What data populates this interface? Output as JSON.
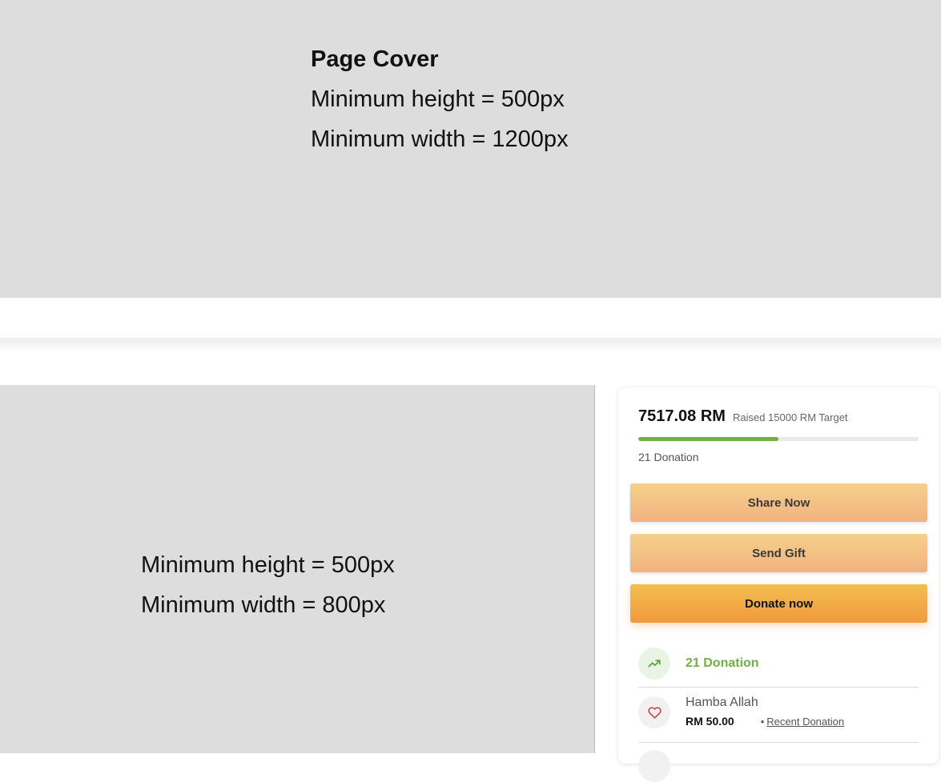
{
  "cover": {
    "title": "Page Cover",
    "min_height": "Minimum height = 500px",
    "min_width": "Minimum width = 1200px"
  },
  "media": {
    "min_height": "Minimum height = 500px",
    "min_width": "Minimum width = 800px"
  },
  "campaign": {
    "raised_amount": "7517.08 RM",
    "raised_sub": "Raised 15000 RM Target",
    "progress": 0.5,
    "donation_count": "21 Donation"
  },
  "actions": {
    "share": "Share Now",
    "gift": "Send Gift",
    "donate": "Donate now"
  },
  "stats": {
    "donations_label": "21 Donation",
    "icon": "trending-up-icon"
  },
  "donations": [
    {
      "name": "Hamba Allah",
      "amount": "RM 50.00",
      "tag": "Recent Donation",
      "icon": "heart-icon"
    }
  ],
  "colors": {
    "accent_green": "#72b043",
    "donate_orange": "#ef9a3f",
    "placeholder_grey": "#dddddd",
    "heart_red": "#d63b3b"
  }
}
